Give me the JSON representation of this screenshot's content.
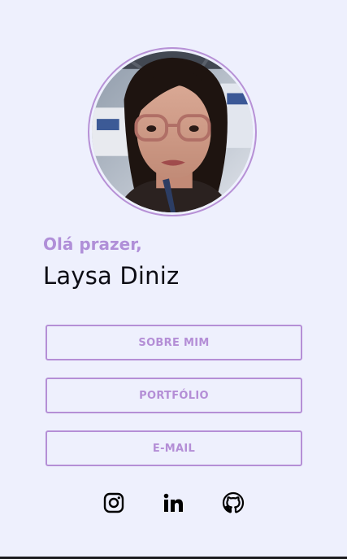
{
  "profile": {
    "avatar_alt": "profile-photo",
    "greeting": "Olá prazer,",
    "name": "Laysa Diniz"
  },
  "nav": {
    "about": "SOBRE MIM",
    "portfolio": "PORTFÓLIO",
    "email": "E-MAIL"
  },
  "social": {
    "icons": [
      "instagram-icon",
      "linkedin-icon",
      "github-icon"
    ]
  },
  "colors": {
    "background": "#eef0fd",
    "accent": "#b48ed6",
    "text": "#0c0c14"
  }
}
